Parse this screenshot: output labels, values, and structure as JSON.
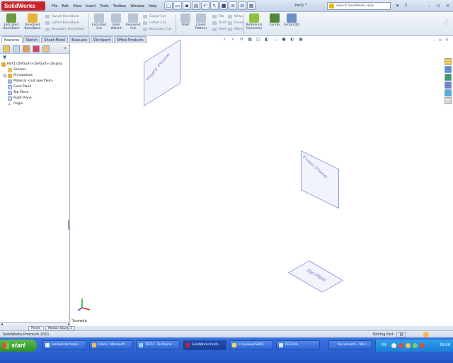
{
  "app": {
    "logo": "SolidWorks",
    "document_title": "Part1 *",
    "menus": [
      "File",
      "Edit",
      "View",
      "Insert",
      "Tools",
      "Toolbox",
      "Window",
      "Help"
    ],
    "help_search_placeholder": "Search SolidWorks Help"
  },
  "command_manager": {
    "big_buttons": [
      {
        "label1": "Extruded",
        "label2": "Boss/Base"
      },
      {
        "label1": "Revolved",
        "label2": "Boss/Base"
      },
      {
        "label1": "Extruded",
        "label2": "Cut"
      },
      {
        "label1": "Hole",
        "label2": "Wizard"
      },
      {
        "label1": "Revolved",
        "label2": "Cut"
      },
      {
        "label1": "Fillet",
        "label2": ""
      },
      {
        "label1": "Linear",
        "label2": "Pattern"
      },
      {
        "label1": "Reference",
        "label2": "Geometry"
      },
      {
        "label1": "Curves",
        "label2": ""
      },
      {
        "label1": "Instant3D",
        "label2": ""
      }
    ],
    "small_col_1": [
      "Swept Boss/Base",
      "Lofted Boss/Base",
      "Boundary Boss/Base"
    ],
    "small_col_2": [
      "Swept Cut",
      "Lofted Cut",
      "Boundary Cut"
    ],
    "small_col_3": [
      "Rib",
      "Draft",
      "Shell"
    ],
    "small_col_4": [
      "Wrap",
      "Dome",
      "Mirror"
    ]
  },
  "tabs": [
    "Features",
    "Sketch",
    "Sheet Metal",
    "Evaluate",
    "DimXpert",
    "Office Products"
  ],
  "feature_tree": {
    "root": "Part1 (Default<<Default>_Display",
    "items": [
      "Sensors",
      "Annotations",
      "Material <not specified>",
      "Front Plane",
      "Top Plane",
      "Right Plane",
      "Origin"
    ]
  },
  "viewport": {
    "planes": {
      "right": "Right Plane",
      "front": "Front Plane",
      "top": "Top Plane"
    },
    "view_orientation": "*Isometric"
  },
  "bottom_tabs": [
    "Model",
    "Motion Study 1"
  ],
  "status": {
    "product": "SolidWorks Premium 2011",
    "mode": "Editing Part"
  },
  "taskbar": {
    "start_label": "start",
    "buttons": [
      "solidworks tutori...",
      "Inbox - Microsoft ...",
      "TECH - Technical ...",
      "SolidWorks Profe...",
      "C:\\Lookup\\SWD...",
      "FEGLOA",
      "Document1 - Micr..."
    ],
    "language": "EN",
    "clock": "09:56"
  },
  "colors": {
    "accent": "#c8242b",
    "plane_edge": "#8a9ed6",
    "taskbar": "#2253c4",
    "start": "#2f8f2f"
  }
}
